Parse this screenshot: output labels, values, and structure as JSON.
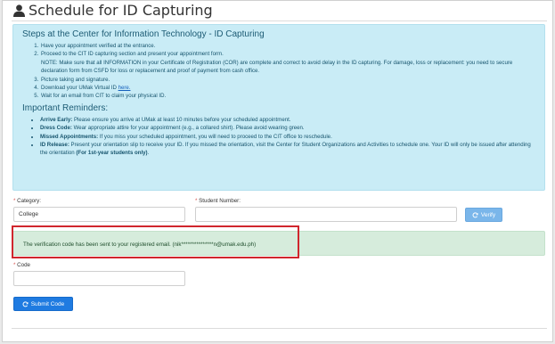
{
  "header": {
    "title": "Schedule for ID Capturing",
    "icon": "user-icon"
  },
  "steps": {
    "title": "Steps at the Center for Information Technology - ID Capturing",
    "items": [
      "Have your appointment verified at the entrance.",
      "Proceed to the CIT ID capturing section and present your appointment form.",
      "NOTE: Make sure that all INFORMATION in your Certificate of Registration (COR) are complete and correct to avoid delay in the ID capturing. For damage, loss or replacement: you need to secure declaration form from CSFD for loss or replacement and proof of payment from cash office.",
      "Picture taking and signature.",
      "Download your UMak Virtual ID ",
      "Wait for an email from CIT to claim your physical ID."
    ],
    "link_text": "here."
  },
  "reminders": {
    "title": "Important Reminders:",
    "items": [
      {
        "label": "Arrive Early:",
        "text": " Please ensure you arrive at UMak at least 10 minutes before your scheduled appointment."
      },
      {
        "label": "Dress Code:",
        "text": " Wear appropriate attire for your appointment (e.g., a collared shirt). Please avoid wearing green."
      },
      {
        "label": "Missed Appointments:",
        "text": " If you miss your scheduled appointment, you will need to proceed to the CIT office to reschedule."
      },
      {
        "label": "ID Release:",
        "text": " Present your orientation slip to receive your ID. If you missed the orientation, visit the Center for Student Organizations and Activities to schedule one. Your ID will only be issued after attending the orientation ",
        "bold_tail": "(For 1st-year students only)",
        "tail": "."
      }
    ]
  },
  "form": {
    "required_mark": "*",
    "category_label": "Category:",
    "category_value": "College",
    "student_number_label": "Student Number:",
    "student_number_value": "",
    "verify_label": "Verify",
    "verification_message": "The verification code has been sent to your registered email. (nik***************n@umak.edu.ph)",
    "code_label": "Code",
    "code_value": "",
    "submit_label": "Submit Code"
  },
  "colors": {
    "info_bg": "#c9ecf6",
    "success_bg": "#d6ecdc",
    "primary": "#1f7be1",
    "verify": "#7ab6ea",
    "highlight": "#d0262d",
    "required": "#d9534f"
  }
}
